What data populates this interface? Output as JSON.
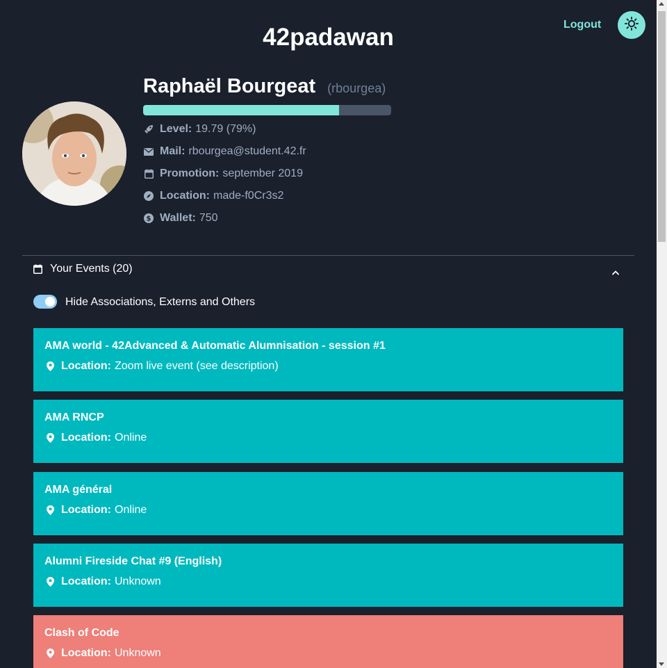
{
  "header": {
    "site_title": "42padawan",
    "logout_label": "Logout",
    "theme_icon": "sun-icon"
  },
  "profile": {
    "full_name": "Raphaël Bourgeat",
    "login": "(rbourgea)",
    "level_progress_percent": 79,
    "fields": [
      {
        "icon": "rocket-icon",
        "label": "Level:",
        "value": "19.79 (79%)"
      },
      {
        "icon": "mail-icon",
        "label": "Mail:",
        "value": "rbourgea@student.42.fr"
      },
      {
        "icon": "calendar-icon",
        "label": "Promotion:",
        "value": "september 2019"
      },
      {
        "icon": "compass-icon",
        "label": "Location:",
        "value": "made-f0Cr3s2"
      },
      {
        "icon": "dollar-icon",
        "label": "Wallet:",
        "value": "750"
      }
    ]
  },
  "events": {
    "heading": "Your Events (20)",
    "toggle_label": "Hide Associations, Externs and Others",
    "toggle_on": true,
    "location_label": "Location:",
    "items": [
      {
        "title": "AMA world - 42Advanced & Automatic Alumnisation - session #1",
        "location": "Zoom live event (see description)",
        "color": "#00b9bf"
      },
      {
        "title": "AMA RNCP",
        "location": "Online",
        "color": "#00b9bf"
      },
      {
        "title": "AMA général",
        "location": "Online",
        "color": "#00b9bf"
      },
      {
        "title": "Alumni Fireside Chat #9 (English)",
        "location": "Unknown",
        "color": "#00b9bf"
      },
      {
        "title": "Clash of Code",
        "location": "Unknown",
        "color": "#ee7f79"
      }
    ]
  },
  "colors": {
    "background": "#1a202c",
    "accent": "#81e6d9",
    "event_teal": "#00b9bf",
    "event_salmon": "#ee7f79"
  }
}
